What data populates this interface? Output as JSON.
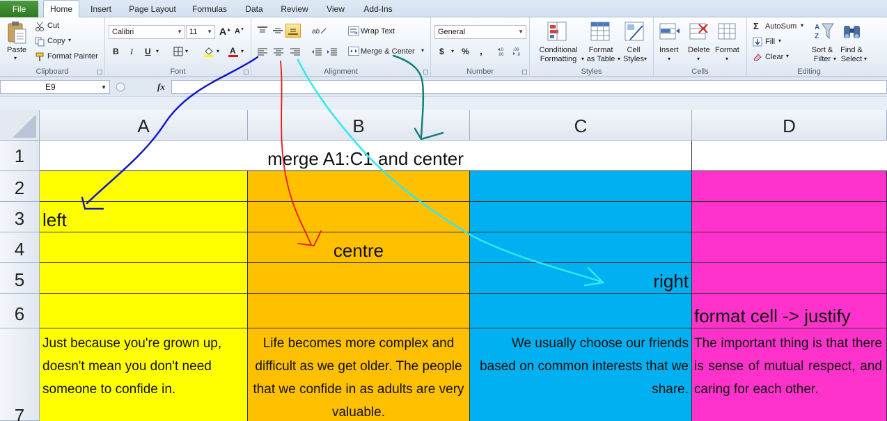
{
  "tabs": {
    "file": "File",
    "items": [
      "Home",
      "Insert",
      "Page Layout",
      "Formulas",
      "Data",
      "Review",
      "View",
      "Add-Ins"
    ]
  },
  "clipboard": {
    "paste": "Paste",
    "cut": "Cut",
    "copy": "Copy",
    "format_painter": "Format Painter",
    "label": "Clipboard"
  },
  "font": {
    "name": "Calibri",
    "size": "11",
    "bold": "B",
    "italic": "I",
    "underline": "U",
    "label": "Font"
  },
  "alignment": {
    "wrap_text": "Wrap Text",
    "merge_center": "Merge & Center",
    "label": "Alignment"
  },
  "number": {
    "format": "General",
    "currency": "$",
    "percent": "%",
    "comma": ",",
    "label": "Number"
  },
  "styles": {
    "conditional": [
      "Conditional",
      "Formatting"
    ],
    "format_table": [
      "Format",
      "as Table"
    ],
    "cell_styles": [
      "Cell",
      "Styles"
    ],
    "label": "Styles"
  },
  "cells": {
    "insert": "Insert",
    "delete": "Delete",
    "format": "Format",
    "label": "Cells"
  },
  "editing": {
    "autosum": "AutoSum",
    "fill": "Fill",
    "clear": "Clear",
    "sort": [
      "Sort &",
      "Filter"
    ],
    "find": [
      "Find &",
      "Select"
    ],
    "label": "Editing"
  },
  "formula_bar": {
    "name_box": "E9",
    "fx": "fx",
    "formula": ""
  },
  "columns": [
    "A",
    "B",
    "C",
    "D"
  ],
  "rows": [
    "1",
    "2",
    "3",
    "4",
    "5",
    "6",
    "7"
  ],
  "cells_data": {
    "r1_merged": "merge A1:C1 and center",
    "a3": "left",
    "b4": "centre",
    "c5": "right",
    "d6": "format cell -> justify",
    "a7": "Just because you're grown up, doesn't mean you don't need someone to confide in.",
    "b7": "Life becomes more complex and difficult as we get older. The people that we confide in as adults are very valuable.",
    "c7": "We usually choose our friends based on common interests that we share.",
    "d7": "The important thing is that there is sense of mutual respect, and caring for each other."
  },
  "colors": {
    "yellow": "#ffff00",
    "orange": "#ffc000",
    "blue": "#00b0f0",
    "pink": "#ff33cc",
    "arrow_left": "#1515c8",
    "arrow_center": "#e81818",
    "arrow_right": "#33e6f0",
    "arrow_merge": "#127f7a"
  }
}
